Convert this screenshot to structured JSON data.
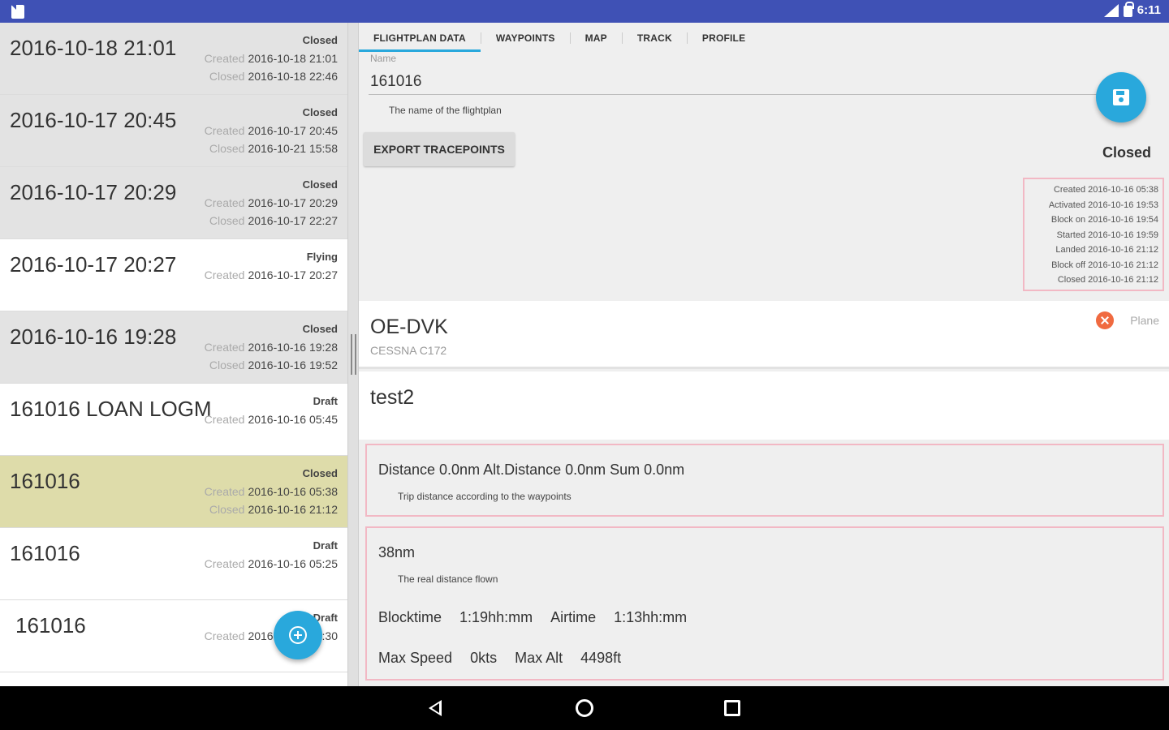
{
  "status_bar": {
    "time": "6:11"
  },
  "list": {
    "items": [
      {
        "title": "2016-10-18 21:01",
        "status": "Closed",
        "created_label": "Created",
        "created": "2016-10-18 21:01",
        "closed_label": "Closed",
        "closed": "2016-10-18 22:46",
        "style": "closed"
      },
      {
        "title": "2016-10-17 20:45",
        "status": "Closed",
        "created_label": "Created",
        "created": "2016-10-17 20:45",
        "closed_label": "Closed",
        "closed": "2016-10-21 15:58",
        "style": "closed"
      },
      {
        "title": "2016-10-17 20:29",
        "status": "Closed",
        "created_label": "Created",
        "created": "2016-10-17 20:29",
        "closed_label": "Closed",
        "closed": "2016-10-17 22:27",
        "style": "closed"
      },
      {
        "title": "2016-10-17 20:27",
        "status": "Flying",
        "created_label": "Created",
        "created": "2016-10-17 20:27",
        "style": "open"
      },
      {
        "title": "2016-10-16 19:28",
        "status": "Closed",
        "created_label": "Created",
        "created": "2016-10-16 19:28",
        "closed_label": "Closed",
        "closed": "2016-10-16 19:52",
        "style": "closed"
      },
      {
        "title": "161016 LOAN LOGM",
        "status": "Draft",
        "created_label": "Created",
        "created": "2016-10-16 05:45",
        "style": "open"
      },
      {
        "title": "161016",
        "status": "Closed",
        "created_label": "Created",
        "created": "2016-10-16 05:38",
        "closed_label": "Closed",
        "closed": "2016-10-16 21:12",
        "style": "selected"
      },
      {
        "title": "161016",
        "status": "Draft",
        "created_label": "Created",
        "created": "2016-10-16 05:25",
        "style": "open"
      },
      {
        "title": "161016",
        "status": "Draft",
        "created_label": "Created",
        "created": "2016-10-16 04:30",
        "style": "open"
      }
    ]
  },
  "tabs": [
    "FLIGHTPLAN DATA",
    "WAYPOINTS",
    "MAP",
    "TRACK",
    "PROFILE"
  ],
  "form": {
    "name_label": "Name",
    "name_value": "161016",
    "name_help": "The name of the flightplan",
    "export_label": "EXPORT TRACEPOINTS",
    "state": "Closed"
  },
  "timeline": [
    "Created 2016-10-16 05:38",
    "Activated 2016-10-16 19:53",
    "Block on 2016-10-16 19:54",
    "Started 2016-10-16 19:59",
    "Landed 2016-10-16 21:12",
    "Block off 2016-10-16 21:12",
    "Closed 2016-10-16 21:12"
  ],
  "plane": {
    "registration": "OE-DVK",
    "type": "CESSNA C172",
    "label": "Plane"
  },
  "note": "test2",
  "distance": {
    "text": "Distance 0.0nm Alt.Distance 0.0nm Sum 0.0nm",
    "help": "Trip distance according to the waypoints"
  },
  "stats": {
    "real_distance": "38nm",
    "real_distance_help": "The real distance flown",
    "blocktime_label": "Blocktime",
    "blocktime": "1:19hh:mm",
    "airtime_label": "Airtime",
    "airtime": "1:13hh:mm",
    "maxspeed_label": "Max Speed",
    "maxspeed": "0kts",
    "maxalt_label": "Max Alt",
    "maxalt": "4498ft"
  },
  "colors": {
    "primary": "#3f51b5",
    "accent": "#29a8dc",
    "selected_row": "#dedcaa",
    "highlight_border": "#f2b8c4"
  }
}
